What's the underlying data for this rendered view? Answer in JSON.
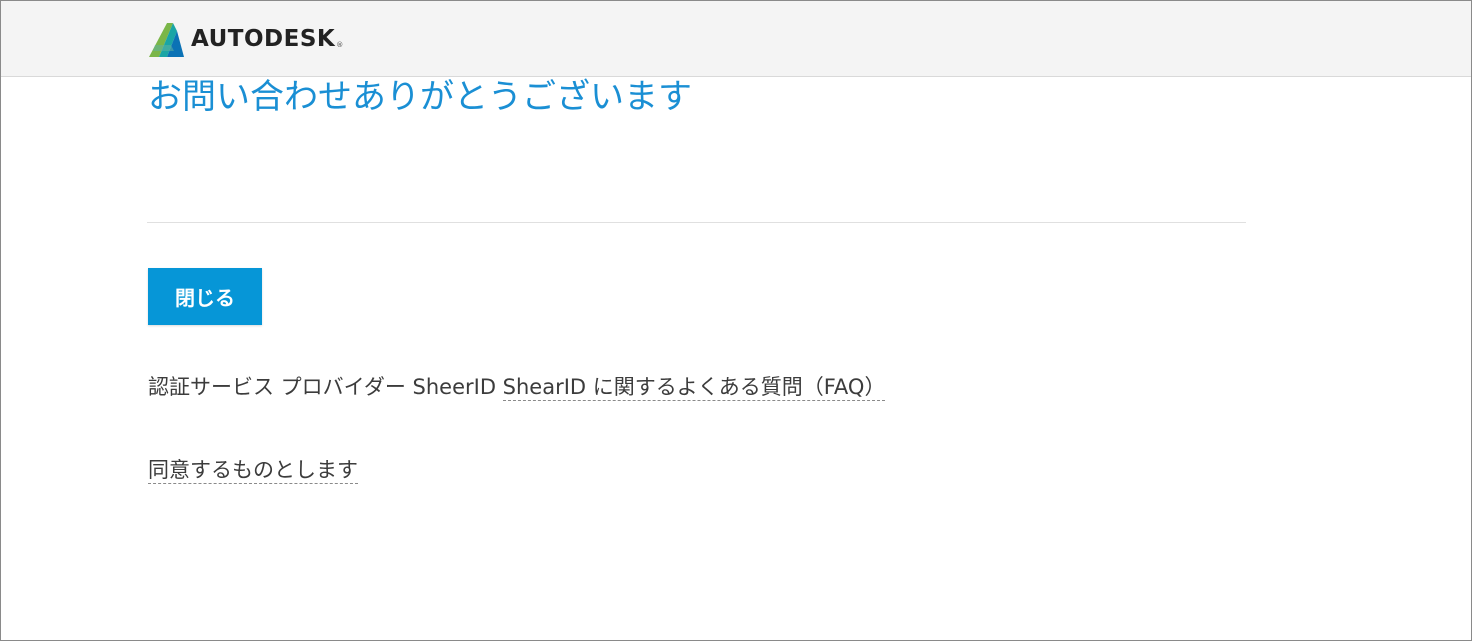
{
  "header": {
    "brand_name": "AUTODESK",
    "brand_registered": "®",
    "logo_icon": "autodesk-logo-icon"
  },
  "main": {
    "title": "お問い合わせありがとうございます",
    "close_button_label": "閉じる",
    "faq_prefix": "認証サービス プロバイダー SheerID ",
    "faq_link_label": "ShearID に関するよくある質問（FAQ）",
    "agree_link_label": "同意するものとします"
  },
  "colors": {
    "title": "#1a8fd4",
    "button_bg": "#0696d7",
    "header_bg": "#f4f4f4",
    "logo_green": "#7ab648",
    "logo_teal": "#1aa5a5",
    "logo_blue": "#0b72b5"
  }
}
